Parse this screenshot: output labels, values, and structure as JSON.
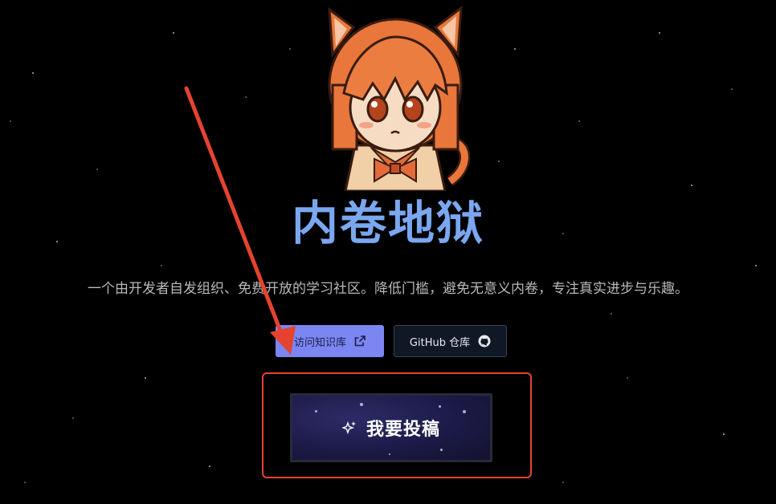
{
  "hero": {
    "title": "内卷地狱",
    "subtitle": "一个由开发者自发组织、免费开放的学习社区。降低门槛，避免无意义内卷，专注真实进步与乐趣。"
  },
  "actions": {
    "knowledge_base_label": "访问知识库",
    "knowledge_base_icon": "external-link-icon",
    "github_label": "GitHub 仓库",
    "github_icon": "github-icon",
    "submit_label": "我要投稿",
    "submit_icon": "sparkles-icon"
  },
  "colors": {
    "background": "#000000",
    "title": "#7aa7f0",
    "primary_button": "#7b86f3",
    "secondary_button": "#101826",
    "annotation": "#e5432f"
  }
}
